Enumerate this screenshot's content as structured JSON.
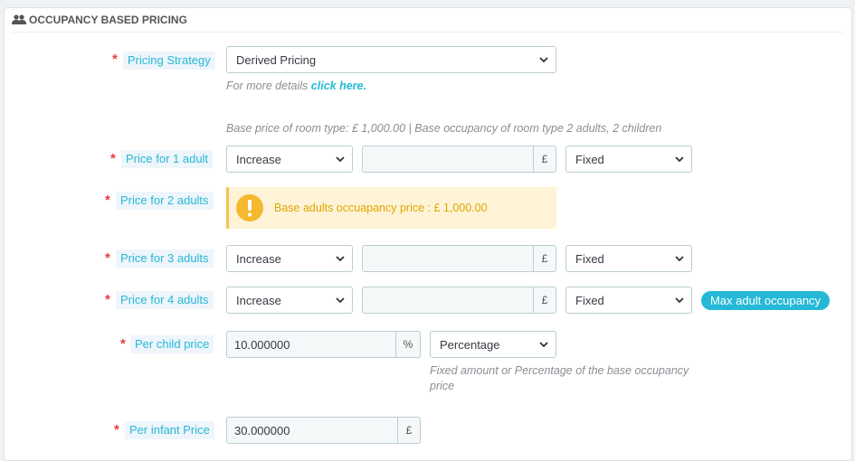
{
  "section": {
    "title": "OCCUPANCY BASED PRICING",
    "icon": "users-icon"
  },
  "pricing_strategy": {
    "label": "Pricing Strategy",
    "value": "Derived Pricing",
    "help_prefix": "For more details",
    "help_link": "click here."
  },
  "base_info": "Base price of room type: £ 1,000.00  |  Base occupancy of room type 2 adults, 2 children",
  "adult_rows": [
    {
      "label": "Price for 1 adult",
      "mode": "Increase",
      "amount": "",
      "currency": "£",
      "type": "Fixed"
    },
    {
      "label": "Price for 3 adults",
      "mode": "Increase",
      "amount": "",
      "currency": "£",
      "type": "Fixed"
    },
    {
      "label": "Price for 4 adults",
      "mode": "Increase",
      "amount": "",
      "currency": "£",
      "type": "Fixed"
    }
  ],
  "two_adults": {
    "label": "Price for 2 adults",
    "warning": "Base adults occuapancy price : £ 1,000.00"
  },
  "max_badge": "Max adult occupancy",
  "child": {
    "label": "Per child price",
    "value": "10.000000",
    "unit": "%",
    "type": "Percentage",
    "help_line1": "Fixed amount or Percentage of the base occupancy",
    "help_line2": "price"
  },
  "infant": {
    "label": "Per infant Price",
    "value": "30.000000",
    "unit": "£"
  },
  "required_mark": "*",
  "colors": {
    "accent": "#25b9d7",
    "required": "#e83d3d",
    "warning_bg": "#fff3d7",
    "warning_text": "#e0a600"
  }
}
